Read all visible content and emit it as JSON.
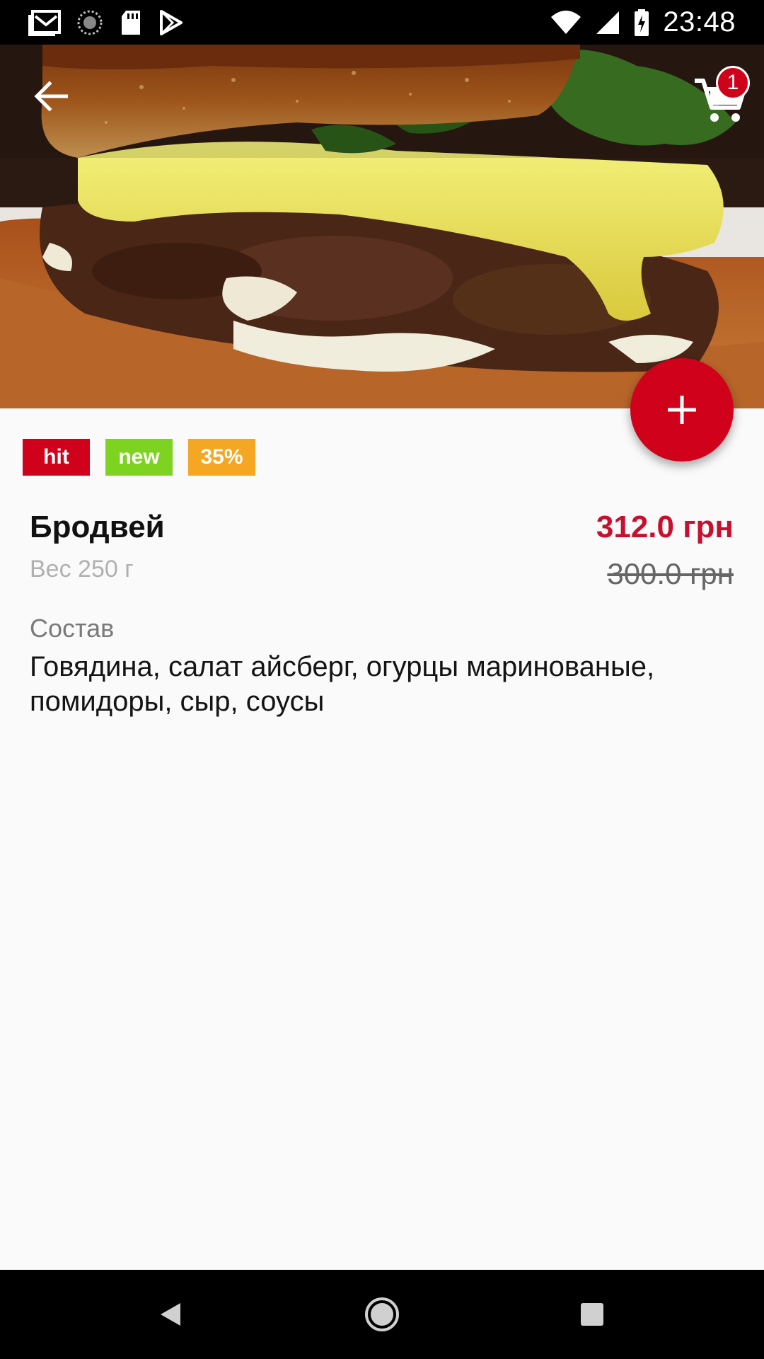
{
  "status_bar": {
    "time": "23:48",
    "left_icons": [
      "gmail-icon",
      "sync-icon",
      "sd-card-icon",
      "play-store-icon"
    ],
    "right_icons": [
      "wifi-icon",
      "signal-icon",
      "battery-charging-icon"
    ]
  },
  "toolbar": {
    "back_icon": "arrow-left-icon",
    "cart_icon": "cart-icon",
    "cart_count": "1"
  },
  "tags": [
    {
      "label": "hit",
      "color": "#d0021b"
    },
    {
      "label": "new",
      "color": "#7ed321"
    },
    {
      "label": "35%",
      "color": "#f5a623"
    }
  ],
  "product": {
    "name": "Бродвей",
    "weight": "Вес 250 г",
    "price": "312.0 грн",
    "old_price": "300.0 грн",
    "composition_label": "Состав",
    "composition": "Говядина, салат айсберг, огурцы маринованые, помидоры, сыр, соусы"
  },
  "fab": {
    "icon": "plus-icon",
    "color": "#d0021b"
  },
  "nav_bar": {
    "icons": [
      "back-triangle-icon",
      "home-circle-icon",
      "recents-square-icon"
    ]
  }
}
